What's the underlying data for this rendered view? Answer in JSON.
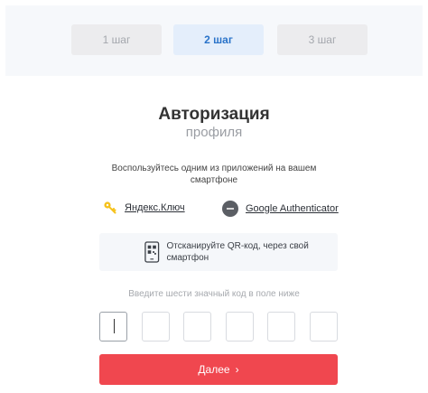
{
  "steps": [
    {
      "label": "1 шаг",
      "state": "inactive"
    },
    {
      "label": "2 шаг",
      "state": "active"
    },
    {
      "label": "3 шаг",
      "state": "inactive"
    }
  ],
  "heading": {
    "title": "Авторизация",
    "subtitle": "профиля"
  },
  "instruction": "Воспользуйтесь одним из приложений на вашем смартфоне",
  "apps": [
    {
      "label": "Яндекс.Ключ",
      "icon": "key-icon"
    },
    {
      "label": "Google Authenticator",
      "icon": "google-authenticator-icon"
    }
  ],
  "qr": {
    "text": "Отсканируйте QR-код, через свой смартфон",
    "icon": "qr-phone-icon"
  },
  "code": {
    "hint": "Введите шести значный код в поле ниже",
    "values": [
      "",
      "",
      "",
      "",
      "",
      ""
    ]
  },
  "next_button": {
    "label": "Далее",
    "icon": "chevron-right-icon"
  },
  "colors": {
    "accent": "#f0474f",
    "active_step": "#2a73c9",
    "active_step_bg": "#e4eefb"
  }
}
